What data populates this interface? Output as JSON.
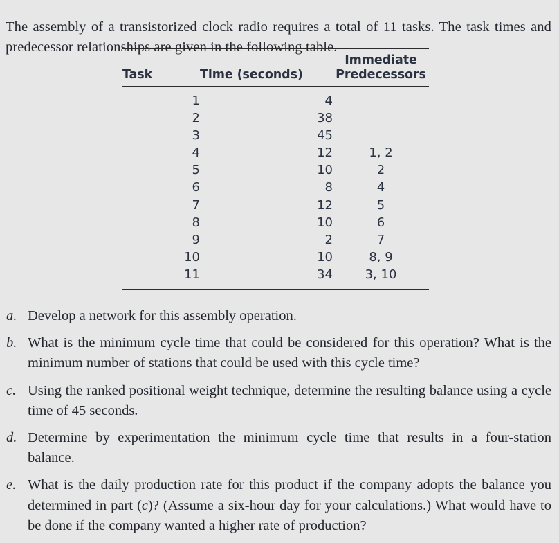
{
  "background_color": "#e7e7e7",
  "text_color": "#23272e",
  "table_text_color": "#2a3140",
  "rule_color": "#2c2c2c",
  "intro": {
    "paragraph": "The assembly of a transistorized clock radio requires a total of 11 tasks. The task times and predecessor relationships are given in the following table."
  },
  "table": {
    "headers": {
      "task": "Task",
      "time": "Time (seconds)",
      "predecessors_line1": "Immediate",
      "predecessors_line2": "Predecessors"
    },
    "rows": [
      {
        "task": "1",
        "time": "4",
        "predecessors": ""
      },
      {
        "task": "2",
        "time": "38",
        "predecessors": ""
      },
      {
        "task": "3",
        "time": "45",
        "predecessors": ""
      },
      {
        "task": "4",
        "time": "12",
        "predecessors": "1, 2"
      },
      {
        "task": "5",
        "time": "10",
        "predecessors": "2"
      },
      {
        "task": "6",
        "time": "8",
        "predecessors": "4"
      },
      {
        "task": "7",
        "time": "12",
        "predecessors": "5"
      },
      {
        "task": "8",
        "time": "10",
        "predecessors": "6"
      },
      {
        "task": "9",
        "time": "2",
        "predecessors": "7"
      },
      {
        "task": "10",
        "time": "10",
        "predecessors": "8, 9"
      },
      {
        "task": "11",
        "time": "34",
        "predecessors": "3, 10"
      }
    ]
  },
  "questions": [
    {
      "marker": "a.",
      "text": "Develop a network for this assembly operation."
    },
    {
      "marker": "b.",
      "text": "What is the minimum cycle time that could be considered for this operation? What is the minimum number of stations that could be used with this cycle time?"
    },
    {
      "marker": "c.",
      "text": "Using the ranked positional weight technique, determine the resulting balance using a cycle time of 45 seconds."
    },
    {
      "marker": "d.",
      "text": "Determine by experimentation the minimum cycle time that results in a four-station balance."
    },
    {
      "marker": "e",
      "text_part1": "What is the daily production rate for this product if the company adopts the balance you determined in part (",
      "text_italic": "c",
      "text_part2": ")? (Assume a six-hour day for your calculations.) What would have to be done if the company wanted a higher rate of production?",
      "marker_full": "e."
    }
  ]
}
